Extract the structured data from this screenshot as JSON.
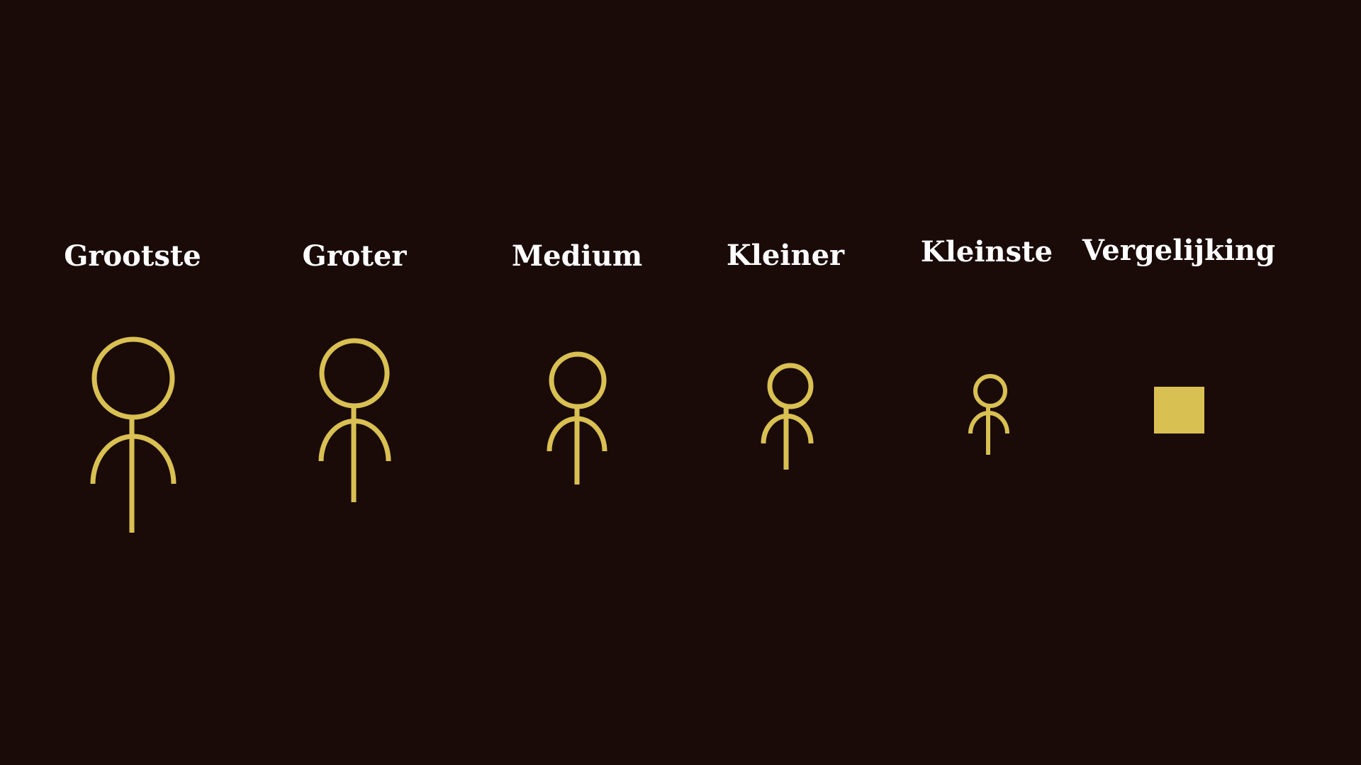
{
  "colors": {
    "background": "#1a0b09",
    "figure": "#d9c052",
    "label": "#ffffff"
  },
  "figures": [
    {
      "label": "Grootste",
      "icon": "stick-figure-icon"
    },
    {
      "label": "Groter",
      "icon": "stick-figure-icon"
    },
    {
      "label": "Medium",
      "icon": "stick-figure-icon"
    },
    {
      "label": "Kleiner",
      "icon": "stick-figure-icon"
    },
    {
      "label": "Kleinste",
      "icon": "stick-figure-icon"
    }
  ],
  "comparison": {
    "label": "Vergelijking",
    "icon": "square-icon"
  }
}
